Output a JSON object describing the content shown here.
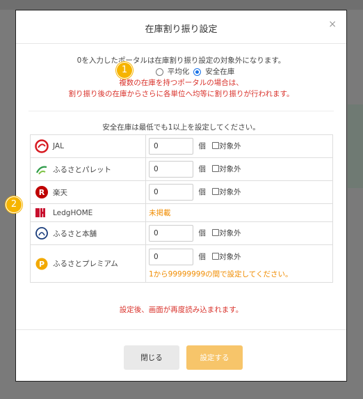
{
  "modal": {
    "title": "在庫割り振り設定",
    "close_glyph": "×"
  },
  "notice": {
    "line1": "0を入力したポータルは在庫割り振り設定の対象外になります。",
    "radio_average": "平均化",
    "radio_safety": "安全在庫",
    "selected": "安全在庫",
    "red_line1": "複数の在庫を持つポータルの場合は、",
    "red_line2": "割り振り後の在庫からさらに各単位へ均等に割り振りが行われます。"
  },
  "min_note": "安全在庫は最低でも1以上を設定してください。",
  "portals": [
    {
      "name": "JAL",
      "icon": "jal-logo-icon",
      "value": "0",
      "unit": "個",
      "exclude_label": "対象外",
      "excluded": false,
      "status": null,
      "error": null
    },
    {
      "name": "ふるさとパレット",
      "icon": "furusato-pallet-logo-icon",
      "value": "0",
      "unit": "個",
      "exclude_label": "対象外",
      "excluded": false,
      "status": null,
      "error": null
    },
    {
      "name": "楽天",
      "icon": "rakuten-logo-icon",
      "value": "0",
      "unit": "個",
      "exclude_label": "対象外",
      "excluded": false,
      "status": null,
      "error": null
    },
    {
      "name": "LedgHOME",
      "icon": "ledghome-logo-icon",
      "value": null,
      "unit": null,
      "exclude_label": null,
      "excluded": false,
      "status": "未掲載",
      "error": null
    },
    {
      "name": "ふるさと本舗",
      "icon": "furusato-honpo-logo-icon",
      "value": "0",
      "unit": "個",
      "exclude_label": "対象外",
      "excluded": false,
      "status": null,
      "error": null
    },
    {
      "name": "ふるさとプレミアム",
      "icon": "furusato-premium-logo-icon",
      "value": "0",
      "unit": "個",
      "exclude_label": "対象外",
      "excluded": false,
      "status": null,
      "error": "1から99999999の間で設定してください。"
    }
  ],
  "reload_note": "設定後、画面が再度読み込まれます。",
  "buttons": {
    "close": "閉じる",
    "submit": "設定する"
  },
  "badges": {
    "one": "1",
    "two": "2"
  },
  "colors": {
    "accent_orange": "#f6b400",
    "error_red": "#d9322b",
    "status_orange": "#f08c00",
    "submit_bg": "#f7c56a"
  }
}
